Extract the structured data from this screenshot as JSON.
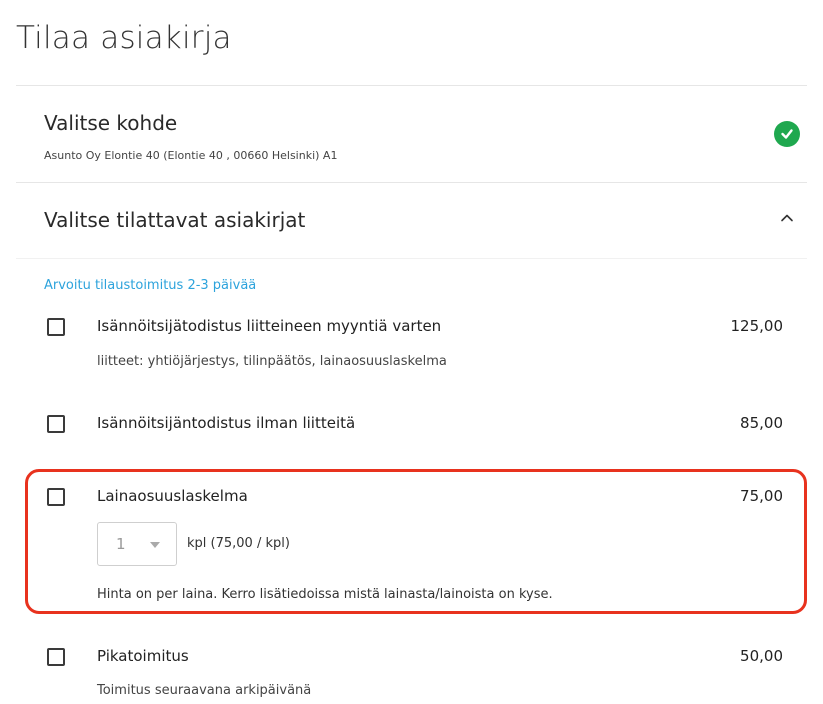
{
  "page": {
    "title": "Tilaa asiakirja"
  },
  "target": {
    "title": "Valitse kohde",
    "address": "Asunto Oy Elontie 40 (Elontie 40 , 00660 Helsinki) A1",
    "status_icon": "check-circle-icon",
    "status_color": "#1fa84f"
  },
  "documents": {
    "title": "Valitse tilattavat asiakirjat",
    "toggle_icon": "chevron-up-icon",
    "delivery_note": "Arvoitu tilaustoimitus 2-3 päivää",
    "accent_color": "#2da3dc",
    "items": [
      {
        "label": "Isännöitsijätodistus liitteineen myyntiä varten",
        "price": "125,00",
        "desc": "liitteet: yhtiöjärjestys, tilinpäätös, lainaosuuslaskelma",
        "checked": false
      },
      {
        "label": "Isännöitsijäntodistus ilman liitteitä",
        "price": "85,00",
        "checked": false
      },
      {
        "label": "Lainaosuuslaskelma",
        "price": "75,00",
        "quantity": "1",
        "quantity_unit": "kpl (75,00 / kpl)",
        "desc": "Hinta on per laina. Kerro lisätiedoissa mistä lainasta/lainoista on kyse.",
        "checked": false,
        "highlight_color": "#e8321e"
      },
      {
        "label": "Pikatoimitus",
        "price": "50,00",
        "desc": "Toimitus seuraavana arkipäivänä",
        "checked": false
      }
    ]
  }
}
